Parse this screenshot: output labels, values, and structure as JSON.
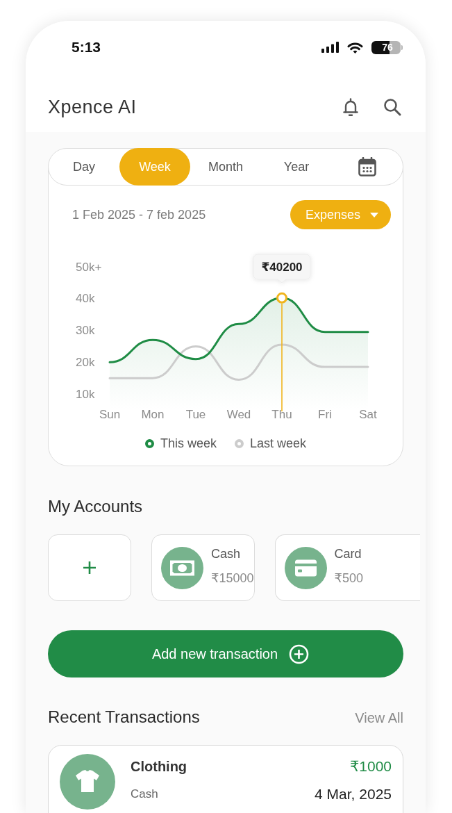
{
  "status_bar": {
    "time": "5:13",
    "battery": "76"
  },
  "header": {
    "title": "Xpence AI"
  },
  "chart_card": {
    "period_tabs": [
      {
        "label": "Day",
        "selected": false
      },
      {
        "label": "Week",
        "selected": true
      },
      {
        "label": "Month",
        "selected": false
      },
      {
        "label": "Year",
        "selected": false
      }
    ],
    "date_range": "1 Feb 2025 - 7 feb 2025",
    "filter": "Expenses",
    "chart_data": {
      "type": "line",
      "categories": [
        "Sun",
        "Mon",
        "Tue",
        "Wed",
        "Thu",
        "Fri",
        "Sat"
      ],
      "series": [
        {
          "name": "This week",
          "type": "area",
          "color": "#1f8c45",
          "values": [
            20000,
            27000,
            21000,
            32000,
            40200,
            29500,
            29500
          ]
        },
        {
          "name": "Last week",
          "type": "line",
          "color": "#cccccc",
          "values": [
            15000,
            15000,
            25000,
            14500,
            25500,
            18500,
            18500
          ]
        }
      ],
      "ylim": [
        10000,
        50000
      ],
      "yticks": [
        {
          "value": 10000,
          "label": "10k"
        },
        {
          "value": 20000,
          "label": "20k"
        },
        {
          "value": 30000,
          "label": "30k"
        },
        {
          "value": 40000,
          "label": "40k"
        },
        {
          "value": 50000,
          "label": "50k+"
        }
      ],
      "ref_lines": [
        {
          "axis": "x",
          "value": "Thu",
          "color": "#f0b41c"
        }
      ],
      "annotations": [
        {
          "x": "Thu",
          "y": 40200,
          "text": "₹40200"
        }
      ]
    }
  },
  "accounts": {
    "title": "My Accounts",
    "items": [
      {
        "kind": "add"
      },
      {
        "kind": "cash",
        "name": "Cash",
        "amount": "₹15000"
      },
      {
        "kind": "card",
        "name": "Card",
        "amount": "₹500"
      }
    ]
  },
  "add_transaction_button": {
    "label": "Add new transaction"
  },
  "recent_transactions": {
    "title": "Recent Transactions",
    "view_all": "View All",
    "items": [
      {
        "category": "Clothing",
        "account": "Cash",
        "amount": "₹1000",
        "date": "4 Mar, 2025"
      }
    ]
  }
}
